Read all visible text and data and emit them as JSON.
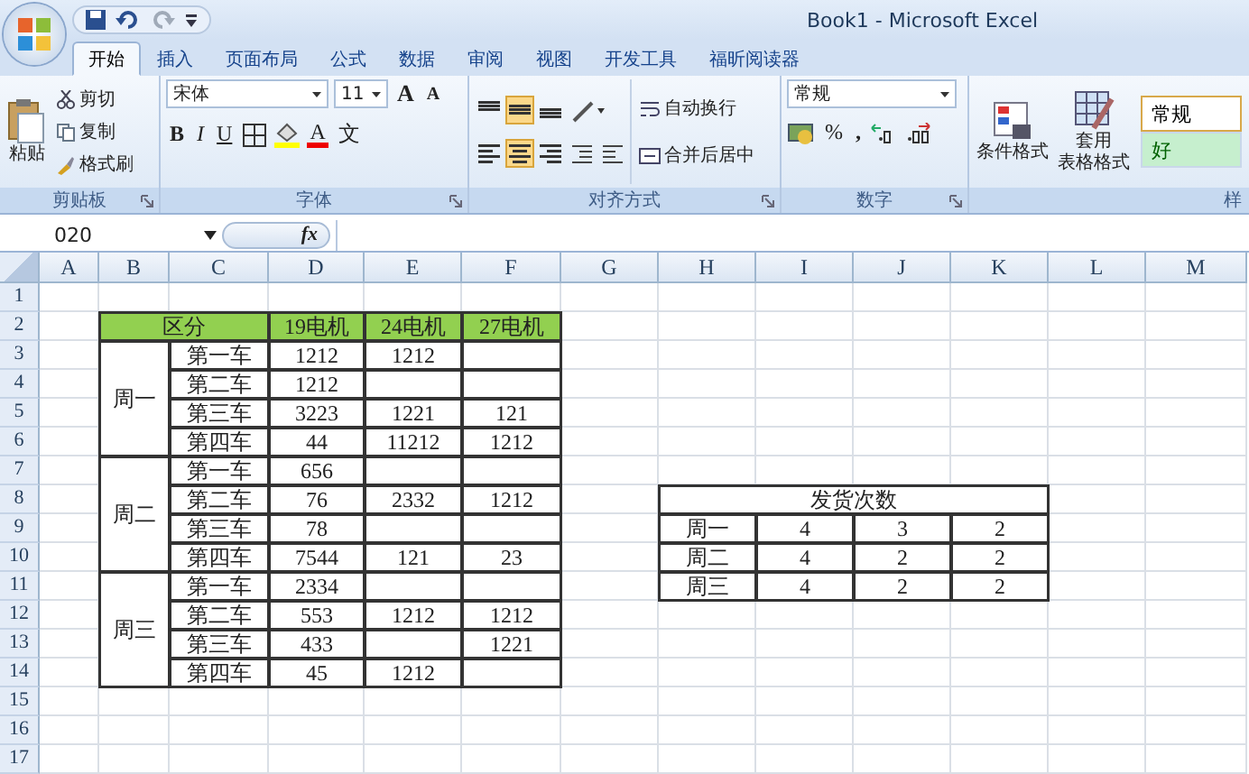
{
  "window": {
    "title": "Book1 - Microsoft Excel"
  },
  "tabs": [
    {
      "label": "开始",
      "selected": true
    },
    {
      "label": "插入",
      "selected": false
    },
    {
      "label": "页面布局",
      "selected": false
    },
    {
      "label": "公式",
      "selected": false
    },
    {
      "label": "数据",
      "selected": false
    },
    {
      "label": "审阅",
      "selected": false
    },
    {
      "label": "视图",
      "selected": false
    },
    {
      "label": "开发工具",
      "selected": false
    },
    {
      "label": "福昕阅读器",
      "selected": false
    }
  ],
  "ribbon": {
    "clipboard": {
      "label": "剪贴板",
      "paste": "粘贴",
      "items": [
        {
          "kind": "cut",
          "label": "剪切"
        },
        {
          "kind": "copy",
          "label": "复制"
        },
        {
          "kind": "brush",
          "label": "格式刷"
        }
      ]
    },
    "font": {
      "label": "字体",
      "font_name": "宋体",
      "font_size": "11",
      "grow": "A",
      "shrink": "A",
      "styles": [
        {
          "kind": "bold",
          "label": "B"
        },
        {
          "kind": "italic",
          "label": "I"
        },
        {
          "kind": "underline",
          "label": "U"
        }
      ],
      "font_color": "A",
      "phonetic": "文"
    },
    "alignment": {
      "label": "对齐方式",
      "wrap": "自动换行",
      "merge": "合并后居中",
      "align_buttons": [
        {
          "kind": "top",
          "selected": false
        },
        {
          "kind": "middle",
          "selected": true
        },
        {
          "kind": "bottom",
          "selected": false
        },
        {
          "kind": "left",
          "selected": false
        },
        {
          "kind": "center",
          "selected": true
        },
        {
          "kind": "right",
          "selected": false
        }
      ]
    },
    "number": {
      "label": "数字",
      "format": "常规",
      "percent": "%",
      "comma": ","
    },
    "styles": {
      "label": "样",
      "conditional": "条件格式",
      "table_format": [
        "套用",
        "表格格式"
      ],
      "cell_styles": [
        {
          "kind": "normal",
          "label": "常规"
        },
        {
          "kind": "good",
          "label": "好"
        }
      ]
    }
  },
  "formula_bar": {
    "name_box": "020",
    "fx": "fx"
  },
  "columns": [
    "A",
    "B",
    "C",
    "D",
    "E",
    "F",
    "G",
    "H",
    "I",
    "J",
    "K",
    "L",
    "M"
  ],
  "rows": [
    "1",
    "2",
    "3",
    "4",
    "5",
    "6",
    "7",
    "8",
    "9",
    "10",
    "11",
    "12",
    "13",
    "14",
    "15",
    "16",
    "17"
  ],
  "table_1": {
    "header": [
      "区分",
      "19电机",
      "24电机",
      "27电机"
    ],
    "groups": [
      {
        "day": "周一",
        "rows": [
          {
            "car": "第一车",
            "col_d": "1212",
            "col_e": "1212"
          },
          {
            "car": "第二车",
            "col_d": "1212"
          },
          {
            "car": "第三车",
            "col_d": "3223",
            "col_e": "1221",
            "col_f": "121"
          },
          {
            "car": "第四车",
            "col_d": "44",
            "col_e": "11212",
            "col_f": "1212"
          }
        ]
      },
      {
        "day": "周二",
        "rows": [
          {
            "car": "第一车",
            "col_d": "656"
          },
          {
            "car": "第二车",
            "col_d": "76",
            "col_e": "2332",
            "col_f": "1212"
          },
          {
            "car": "第三车",
            "col_d": "78"
          },
          {
            "car": "第四车",
            "col_d": "7544",
            "col_e": "121",
            "col_f": "23"
          }
        ]
      },
      {
        "day": "周三",
        "rows": [
          {
            "car": "第一车",
            "col_d": "2334"
          },
          {
            "car": "第二车",
            "col_d": "553",
            "col_e": "1212",
            "col_f": "1212"
          },
          {
            "car": "第三车",
            "col_d": "433",
            "col_f": "1221"
          },
          {
            "car": "第四车",
            "col_d": "45",
            "col_e": "1212"
          }
        ]
      }
    ]
  },
  "table_2": {
    "title": "发货次数",
    "rows": [
      {
        "label": "周一",
        "values": [
          "4",
          "3",
          "2"
        ]
      },
      {
        "label": "周二",
        "values": [
          "4",
          "2",
          "2"
        ]
      },
      {
        "label": "周三",
        "values": [
          "4",
          "2",
          "2"
        ]
      }
    ]
  }
}
